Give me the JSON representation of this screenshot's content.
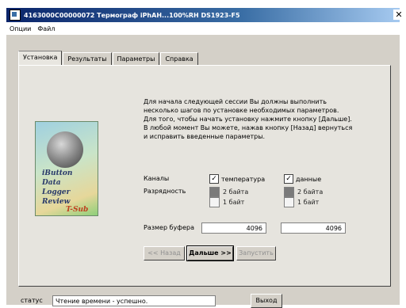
{
  "window": {
    "title": "4163000C00000072  Термограф iPhAH...100%RH  DS1923-F5",
    "close_glyph": "✕"
  },
  "menu": [
    "Опции",
    "Файл"
  ],
  "tabs": [
    "Установка",
    "Результаты",
    "Параметры",
    "Справка"
  ],
  "active_tab": 0,
  "intro_text": "Для начала следующей сессии Вы должны выполнить\nнесколько шагов по установке необходимых параметров.\nДля того, чтобы начать установку нажмите кнопку [Дальше].\nВ любой момент Вы можете, нажав кнопку [Назад] вернуться\nи исправить введенные параметры.",
  "cover": {
    "lines": [
      "iButton",
      "Data",
      "Logger",
      "Review"
    ],
    "sub": "T-Sub"
  },
  "channels": {
    "label": "Каналы",
    "temperature": {
      "label": "температура",
      "checked": true
    },
    "data": {
      "label": "данные",
      "checked": true
    }
  },
  "resolution": {
    "label": "Разрядность",
    "opt_2bytes": "2 байта",
    "opt_1byte": "1 байт"
  },
  "buffer": {
    "label": "Размер буфера",
    "temp_value": "4096",
    "data_value": "4096"
  },
  "buttons": {
    "back": "<< Назад",
    "next": "Дальше >>",
    "start": "Запустить",
    "exit": "Выход"
  },
  "status": {
    "label": "статус",
    "value": "Чтение времени - успешно."
  },
  "icons": {
    "check": "✓"
  }
}
